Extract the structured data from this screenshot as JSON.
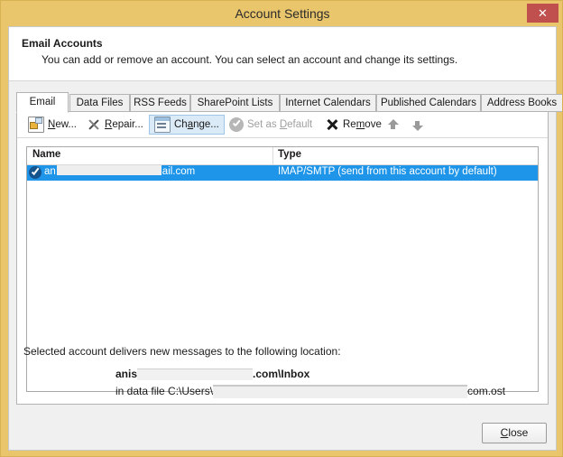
{
  "window": {
    "title": "Account Settings",
    "close_glyph": "✕"
  },
  "header": {
    "title": "Email Accounts",
    "description": "You can add or remove an account. You can select an account and change its settings."
  },
  "tabs": [
    {
      "label": "Email",
      "active": true
    },
    {
      "label": "Data Files",
      "active": false
    },
    {
      "label": "RSS Feeds",
      "active": false
    },
    {
      "label": "SharePoint Lists",
      "active": false
    },
    {
      "label": "Internet Calendars",
      "active": false
    },
    {
      "label": "Published Calendars",
      "active": false
    },
    {
      "label": "Address Books",
      "active": false
    }
  ],
  "toolbar": {
    "new_label": "New...",
    "new_accel": "N",
    "repair_label": "Repair...",
    "repair_accel": "R",
    "change_label": "Change...",
    "change_accel": "a",
    "set_default_label": "Set as Default",
    "set_default_accel": "D",
    "remove_label": "Remove",
    "remove_accel": "m",
    "move_up_label": "Move Up",
    "move_down_label": "Move Down"
  },
  "list": {
    "columns": [
      "Name",
      "Type"
    ],
    "rows": [
      {
        "name_prefix": "an",
        "name_suffix": "ail.com",
        "type": "IMAP/SMTP (send from this account by default)",
        "selected": true,
        "is_default": true
      }
    ]
  },
  "location": {
    "label": "Selected account delivers new messages to the following location:",
    "line1_prefix": "anis",
    "line1_suffix": ".com\\Inbox",
    "line2_prefix": "in data file C:\\Users\\",
    "line2_suffix": "com.ost"
  },
  "footer": {
    "close_label": "Close",
    "close_accel": "C"
  },
  "colors": {
    "window_frame": "#e9c56b",
    "titlebar": "#e9c56b",
    "close_button": "#c0504d",
    "selection": "#1e95e8",
    "hover_fill": "#dbeaf7",
    "hover_border": "#9fc6e8",
    "panel": "#f0f0f0"
  }
}
